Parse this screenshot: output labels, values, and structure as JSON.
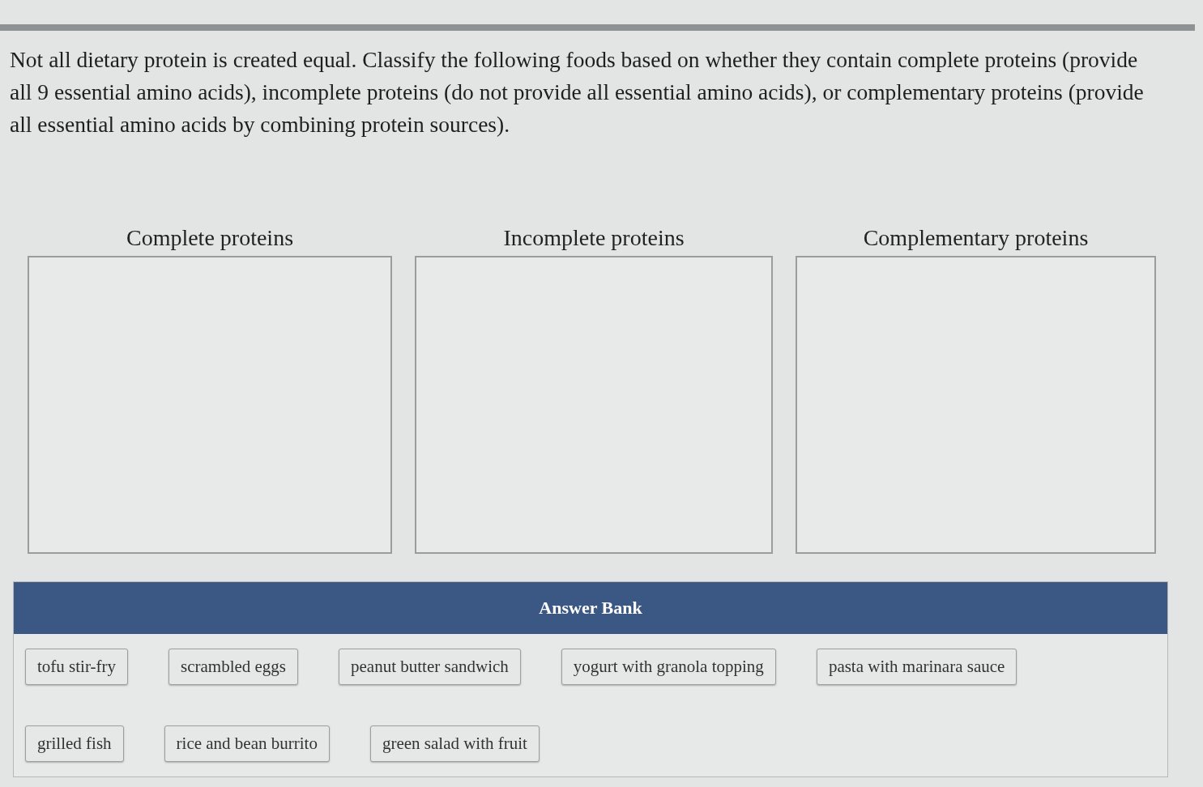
{
  "question": {
    "text": "Not all dietary protein is created equal. Classify the following foods based on whether they contain complete proteins (provide all 9 essential amino acids), incomplete proteins (do not provide all essential amino acids), or complementary proteins (provide all essential amino acids by combining protein sources)."
  },
  "categories": [
    {
      "label": "Complete proteins"
    },
    {
      "label": "Incomplete proteins"
    },
    {
      "label": "Complementary proteins"
    }
  ],
  "answer_bank": {
    "title": "Answer Bank",
    "items": [
      "tofu stir-fry",
      "scrambled eggs",
      "peanut butter sandwich",
      "yogurt with granola topping",
      "pasta with marinara sauce",
      "grilled fish",
      "rice and bean burrito",
      "green salad with fruit"
    ]
  }
}
